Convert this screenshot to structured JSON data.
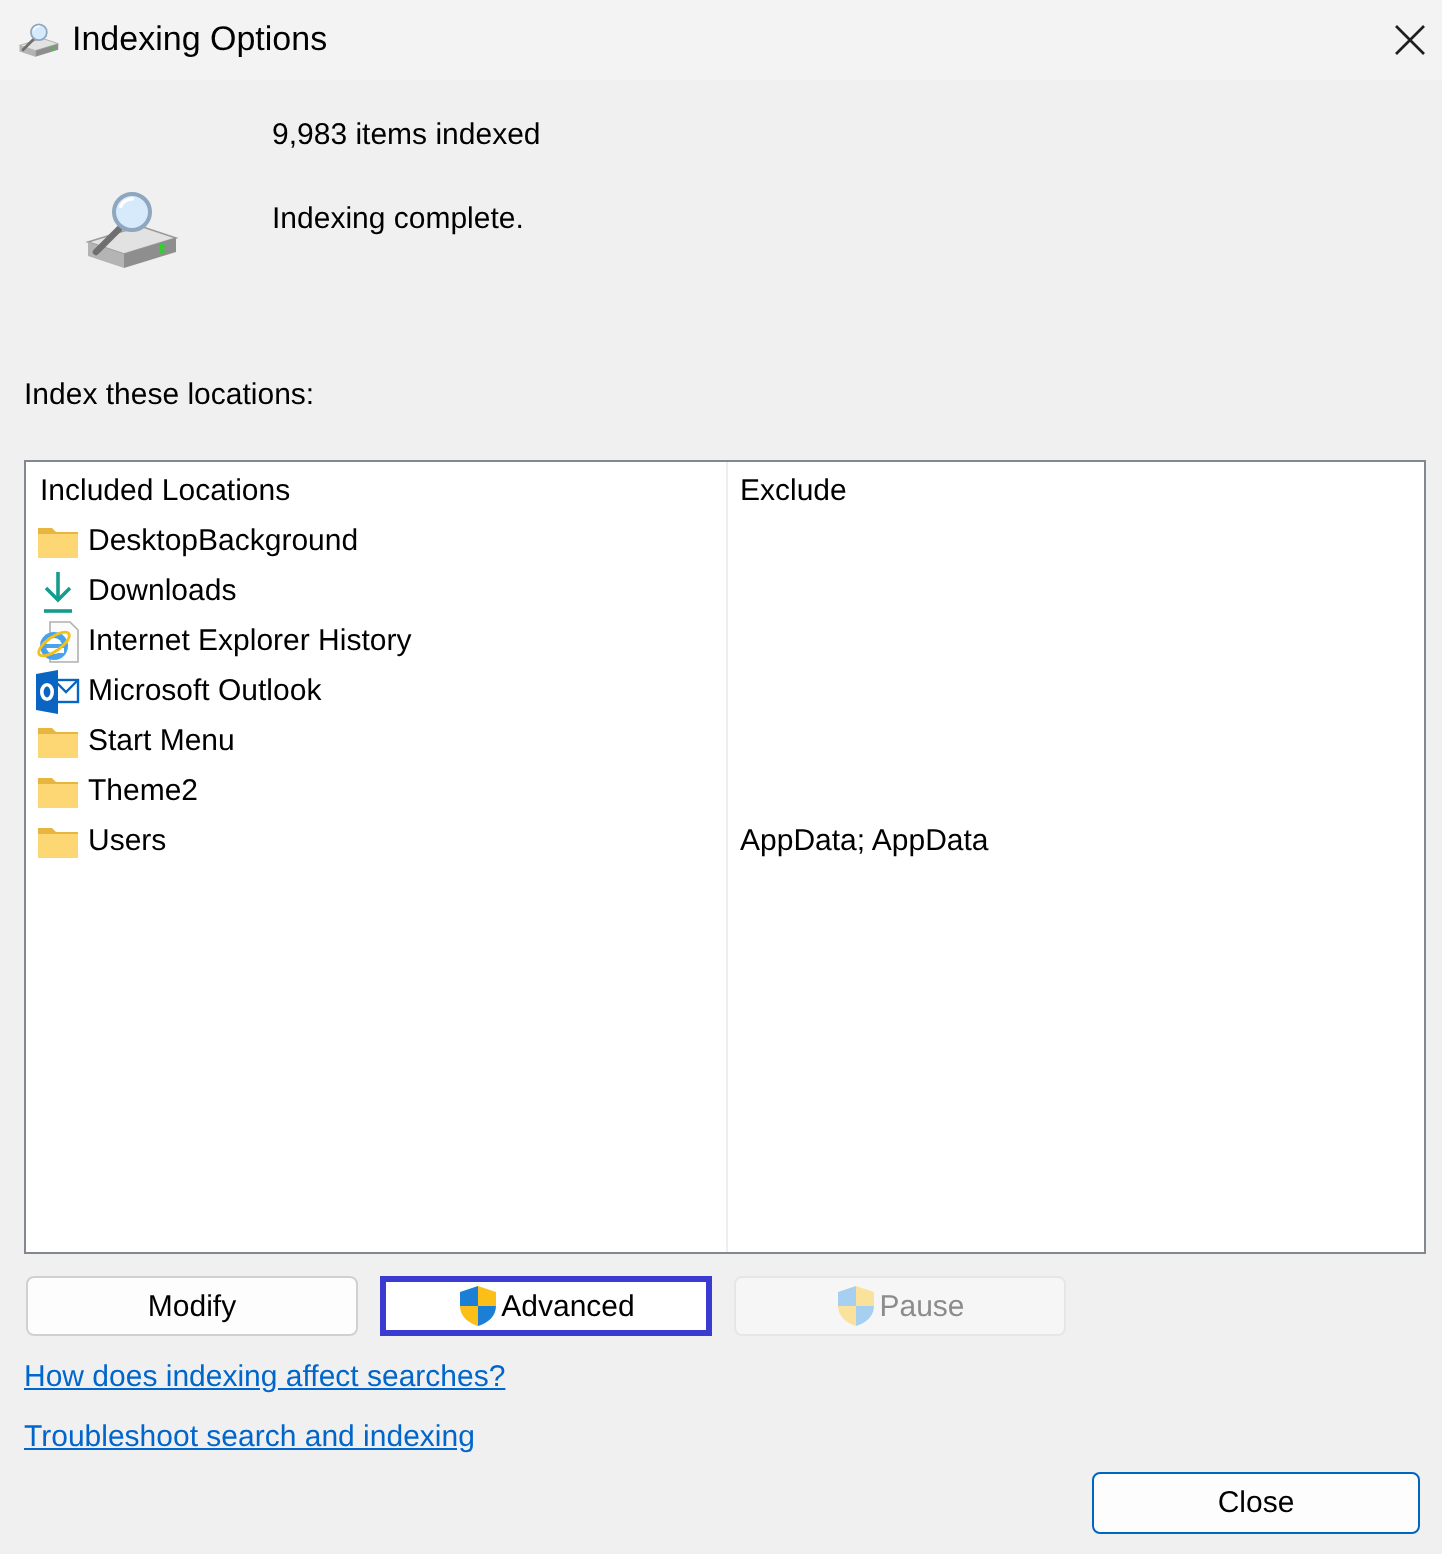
{
  "window": {
    "title": "Indexing Options"
  },
  "status": {
    "count": "9,983 items indexed",
    "message": "Indexing complete."
  },
  "locations_label": "Index these locations:",
  "locations": {
    "columns": [
      "Included Locations",
      "Exclude"
    ],
    "rows": [
      {
        "kind": "folder",
        "name": "DesktopBackground"
      },
      {
        "kind": "download",
        "name": "Downloads"
      },
      {
        "kind": "browser",
        "name": "Internet Explorer History"
      },
      {
        "kind": "mail",
        "name": "Microsoft Outlook"
      },
      {
        "kind": "folder",
        "name": "Start Menu"
      },
      {
        "kind": "folder",
        "name": "Theme2"
      },
      {
        "kind": "folder",
        "name": "Users",
        "exclude": "AppData; AppData"
      }
    ]
  },
  "buttons": [
    {
      "label": "Modify",
      "kind": "plain",
      "disabled": false,
      "highlighted": false
    },
    {
      "label": "Advanced",
      "kind": "shield",
      "disabled": false,
      "highlighted": true
    },
    {
      "label": "Pause",
      "kind": "shield",
      "disabled": true,
      "highlighted": false
    }
  ],
  "links": [
    "How does indexing affect searches?",
    "Troubleshoot search and indexing"
  ],
  "close_button": "Close"
}
